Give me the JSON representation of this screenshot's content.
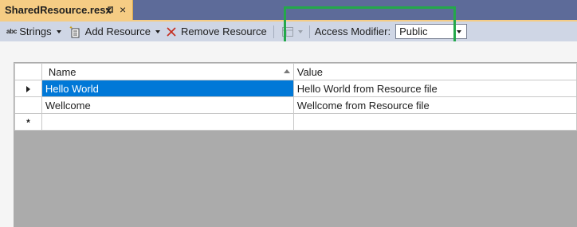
{
  "tab": {
    "title": "SharedResource.resx",
    "pin_glyph": "⌂",
    "close_glyph": "×"
  },
  "toolbar": {
    "strings_icon": "abc",
    "strings_label": "Strings",
    "add_resource_label": "Add Resource",
    "remove_resource_label": "Remove Resource",
    "access_modifier_label": "Access Modifier:",
    "access_modifier_value": "Public"
  },
  "grid": {
    "columns": [
      "Name",
      "Value"
    ],
    "rows": [
      {
        "name": "Hello World",
        "value": "Hello World from Resource file",
        "selected": true
      },
      {
        "name": "Wellcome",
        "value": "Wellcome from Resource file",
        "selected": false
      },
      {
        "name": "",
        "value": "",
        "selected": false
      }
    ],
    "new_row_marker": "*"
  },
  "colors": {
    "highlight": "#24a84a",
    "selection": "#0078d7",
    "tab": "#f5cc84",
    "toolbar": "#cfd6e5"
  },
  "icons": [
    "pin-icon",
    "close-icon",
    "strings-icon",
    "add-resource-icon",
    "remove-icon",
    "grid-view-icon",
    "sort-arrow-icon",
    "current-row-icon"
  ]
}
